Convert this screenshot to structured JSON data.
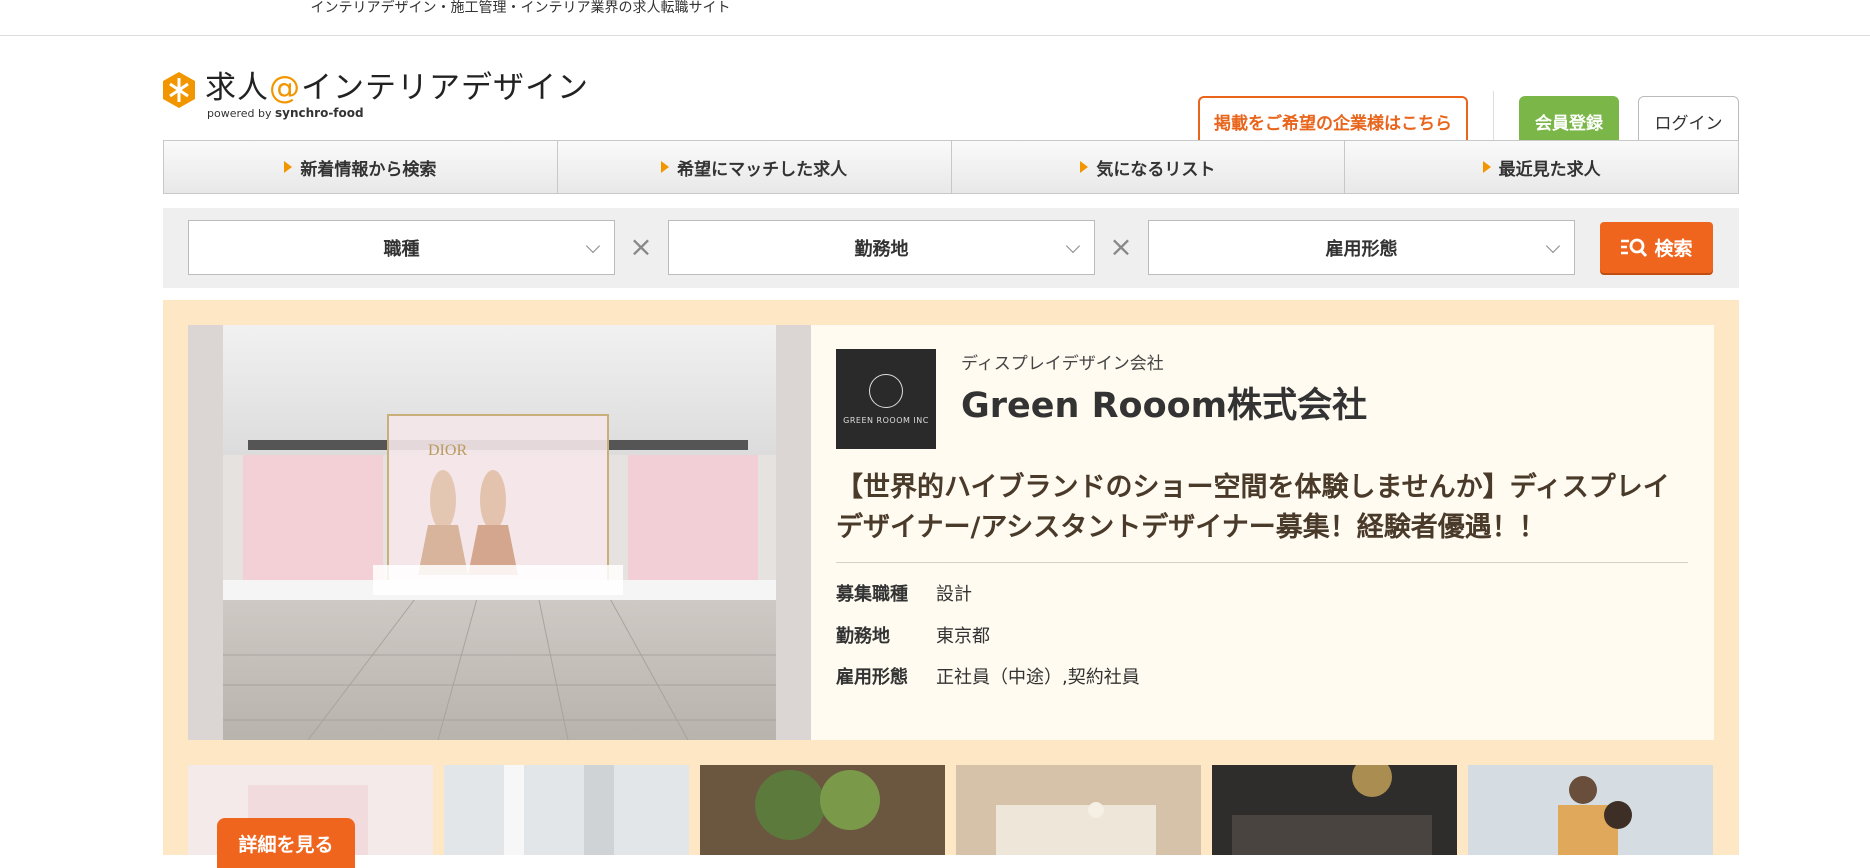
{
  "topbar": {
    "tagline": "インテリアデザイン・施工管理・インテリア業界の求人転職サイト"
  },
  "header": {
    "logo_main": "求人",
    "logo_at": "@",
    "logo_rest": "インテリアデザイン",
    "logo_powered": "powered by",
    "logo_brand": "synchro-food",
    "corp_button": "掲載をご希望の企業様はこちら",
    "register_button": "会員登録",
    "login_button": "ログイン"
  },
  "nav": {
    "items": [
      {
        "label": "新着情報から検索"
      },
      {
        "label": "希望にマッチした求人"
      },
      {
        "label": "気になるリスト"
      },
      {
        "label": "最近見た求人"
      }
    ]
  },
  "search": {
    "job_type": "職種",
    "location": "勤務地",
    "employment": "雇用形態",
    "separator": "×",
    "button": "検索"
  },
  "feature": {
    "company_category": "ディスプレイデザイン会社",
    "company_name": "Green Rooom株式会社",
    "company_logo_text": "GREEN ROOOM INC",
    "photo_sign": "DIOR",
    "job_title": "【世界的ハイブランドのショー空間を体験しませんか】ディスプレイデザイナー/アシスタントデザイナー募集！経験者優遇！！",
    "details": [
      {
        "key": "募集職種",
        "value": "設計"
      },
      {
        "key": "勤務地",
        "value": "東京都"
      },
      {
        "key": "雇用形態",
        "value": "正社員（中途）,契約社員"
      }
    ],
    "detail_button": "詳細を見る"
  },
  "colors": {
    "accent_orange": "#f0651e",
    "logo_orange": "#f29600",
    "register_green": "#7ab648",
    "feature_bg": "#fde7c4"
  }
}
